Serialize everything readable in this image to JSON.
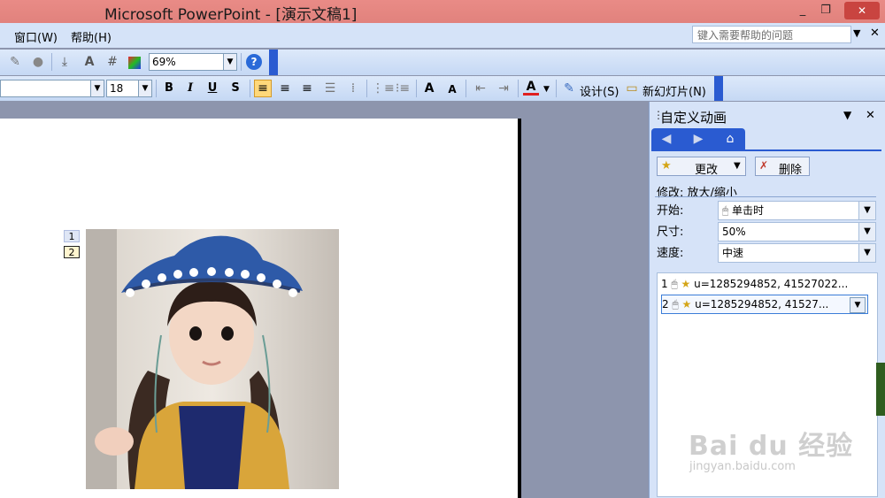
{
  "window": {
    "title": "Microsoft PowerPoint - [演示文稿1]",
    "minimize": "_",
    "restore": "❐",
    "close": "✕"
  },
  "menu": {
    "items": [
      "窗口(W)",
      "帮助(H)"
    ],
    "help_placeholder": "键入需要帮助的问题"
  },
  "toolbar1": {
    "zoom": "69%"
  },
  "toolbar2": {
    "font_size": "18",
    "bold": "B",
    "italic": "I",
    "underline": "U",
    "shadow": "S",
    "design_label": "设计(S)",
    "new_slide_label": "新幻灯片(N)"
  },
  "slide": {
    "tags": [
      "1",
      "2"
    ]
  },
  "task_pane": {
    "title": "自定义动画",
    "change_label": "更改",
    "delete_label": "删除",
    "modify_label": "修改: 放大/缩小",
    "start_label": "开始:",
    "start_value": "单击时",
    "size_label": "尺寸:",
    "size_value": "50%",
    "speed_label": "速度:",
    "speed_value": "中速",
    "animations": [
      {
        "index": "1",
        "text": "u=1285294852, 41527022..."
      },
      {
        "index": "2",
        "text": "u=1285294852, 41527..."
      }
    ]
  },
  "watermark": {
    "brand": "Bai du 经验",
    "url": "jingyan.baidu.com"
  },
  "colors": {
    "titlebar": "#e58782",
    "pane_bg": "#d6e3f8",
    "slide_bg": "#8d95ad",
    "accent": "#2a5bd1"
  }
}
